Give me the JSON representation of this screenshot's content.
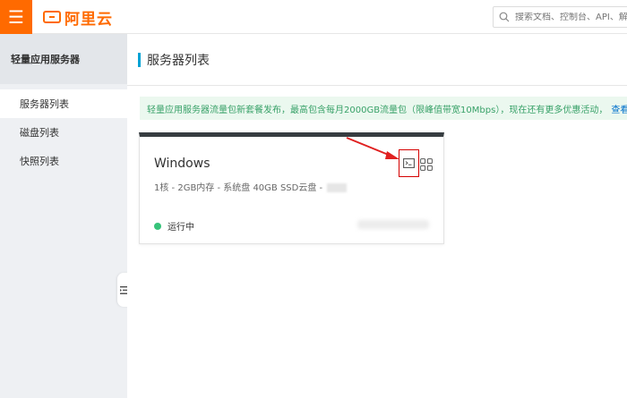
{
  "header": {
    "menu_icon": "hamburger-icon",
    "logo_text": "阿里云",
    "search_placeholder": "搜索文档、控制台、API、解",
    "search_icon": "search-icon"
  },
  "sidebar": {
    "title": "轻量应用服务器",
    "items": [
      {
        "label": "服务器列表",
        "active": true
      },
      {
        "label": "磁盘列表",
        "active": false
      },
      {
        "label": "快照列表",
        "active": false
      }
    ]
  },
  "main": {
    "title": "服务器列表",
    "notice_text": "轻量应用服务器流量包新套餐发布，最高包含每月2000GB流量包（限峰值带宽10Mbps），现在还有更多优惠活动，",
    "notice_link": "查看详情",
    "server": {
      "name": "Windows",
      "spec": "1核 - 2GB内存 - 系统盘 40GB SSD云盘 -",
      "status": "运行中",
      "status_color": "#37c37a",
      "actions": [
        "terminal-icon",
        "grid-icon"
      ]
    }
  },
  "colors": {
    "brand": "#ff6a00",
    "accent": "#00a2d4",
    "notice_bg": "#ebf8ef",
    "notice_text": "#38a168",
    "link": "#0070cc",
    "annotation": "#e02020"
  }
}
